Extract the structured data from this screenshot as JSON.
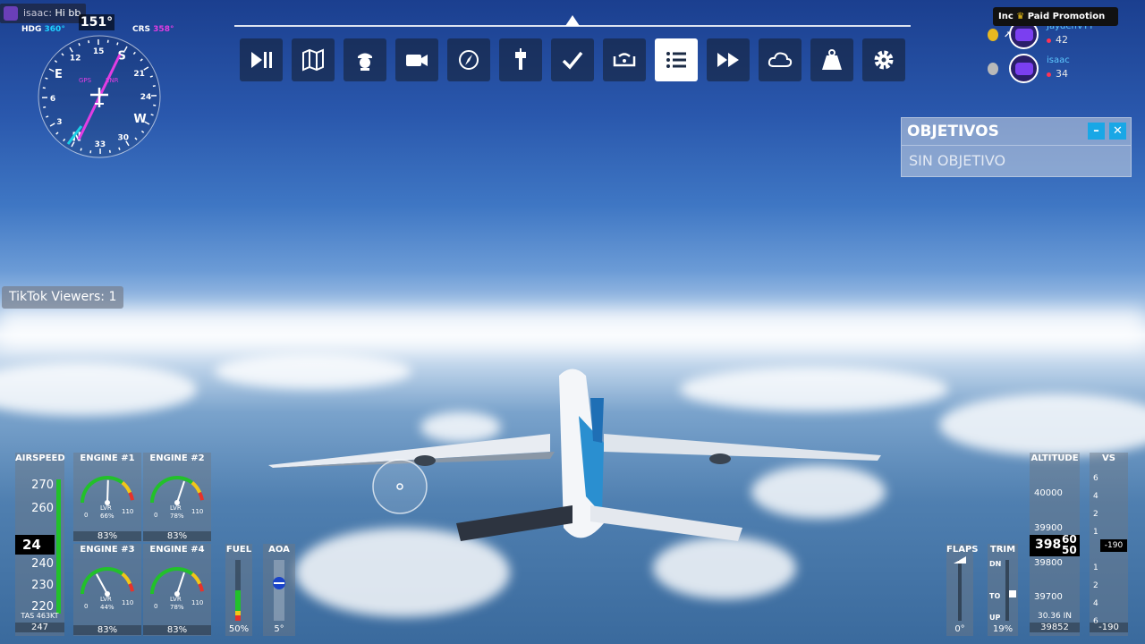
{
  "chat": {
    "user": "isaac:",
    "message": "Hi bb"
  },
  "tiktok": {
    "viewers_label": "TikTok Viewers: 1"
  },
  "toolbar": {
    "buttons": [
      {
        "name": "pause-play",
        "icon": "play-pause-icon",
        "active": false
      },
      {
        "name": "map",
        "icon": "map-icon",
        "active": false
      },
      {
        "name": "pilot",
        "icon": "pilot-icon",
        "active": false
      },
      {
        "name": "camera",
        "icon": "camera-icon",
        "active": false
      },
      {
        "name": "navlog",
        "icon": "compass-icon",
        "active": false
      },
      {
        "name": "atc",
        "icon": "tower-icon",
        "active": false
      },
      {
        "name": "checklist",
        "icon": "check-icon",
        "active": false
      },
      {
        "name": "controls",
        "icon": "yoke-icon",
        "active": false
      },
      {
        "name": "objectives",
        "icon": "list-icon",
        "active": true
      },
      {
        "name": "sim-rate",
        "icon": "fast-forward-icon",
        "active": false
      },
      {
        "name": "weather",
        "icon": "cloud-icon",
        "active": false
      },
      {
        "name": "weight",
        "icon": "weight-icon",
        "active": false
      },
      {
        "name": "settings",
        "icon": "gear-icon",
        "active": false
      }
    ]
  },
  "objectives": {
    "title": "OBJETIVOS",
    "body": "SIN OBJETIVO",
    "minimize": "–",
    "close": "✕"
  },
  "leaderboard": {
    "promo": "Paid Promotion",
    "promo_prefix": "Inc",
    "rows": [
      {
        "name": "JaydenVYT",
        "score": "42"
      },
      {
        "name": "isaac",
        "score": "34"
      }
    ]
  },
  "compass": {
    "heading_readout": "151°",
    "hdg_label": "HDG",
    "hdg_value": "360°",
    "crs_label": "CRS",
    "crs_value": "358°",
    "ticks": [
      "N",
      "3",
      "6",
      "E",
      "12",
      "15",
      "S",
      "21",
      "24",
      "W",
      "30",
      "33"
    ],
    "gps_label": "GPS",
    "enr_label": "ENR"
  },
  "airspeed": {
    "title": "AIRSPEED",
    "ticks": [
      "270",
      "260",
      "240",
      "230",
      "220"
    ],
    "current": "247",
    "current_display": "24",
    "tas": "TAS 463KT",
    "bottom": "247"
  },
  "engines": [
    {
      "title": "ENGINE #1",
      "lvr": "LVR",
      "pct": "66%",
      "min": "0",
      "max": "110",
      "bottom": "83%"
    },
    {
      "title": "ENGINE #2",
      "lvr": "LVR",
      "pct": "78%",
      "min": "0",
      "max": "110",
      "bottom": "83%"
    },
    {
      "title": "ENGINE #3",
      "lvr": "LVR",
      "pct": "44%",
      "min": "0",
      "max": "110",
      "bottom": "83%"
    },
    {
      "title": "ENGINE #4",
      "lvr": "LVR",
      "pct": "78%",
      "min": "0",
      "max": "110",
      "bottom": "83%"
    }
  ],
  "fuel": {
    "title": "FUEL",
    "value": "50%",
    "level": 0.5
  },
  "aoa": {
    "title": "AOA",
    "value": "5°"
  },
  "flaps": {
    "title": "FLAPS",
    "value": "0°"
  },
  "trim": {
    "title": "TRIM",
    "dn": "DN",
    "to": "TO",
    "up": "UP",
    "value": "19%"
  },
  "altitude": {
    "title": "ALTITUDE",
    "ticks": [
      "40000",
      "39900",
      "39800",
      "39700"
    ],
    "current": "398",
    "current_small_top": "60",
    "current_small_bot": "50",
    "baro": "30.36 IN",
    "bottom": "39852"
  },
  "vs": {
    "title": "VS",
    "ticks": [
      "6",
      "4",
      "2",
      "1",
      "1",
      "2",
      "4",
      "6"
    ],
    "indicator": "-190",
    "bottom": "-190"
  },
  "colors": {
    "accent": "#19a7e6",
    "gauge_green": "#22c12a",
    "gauge_amber": "#f2c618",
    "gauge_red": "#e8322a",
    "magenta": "#e23de2"
  }
}
